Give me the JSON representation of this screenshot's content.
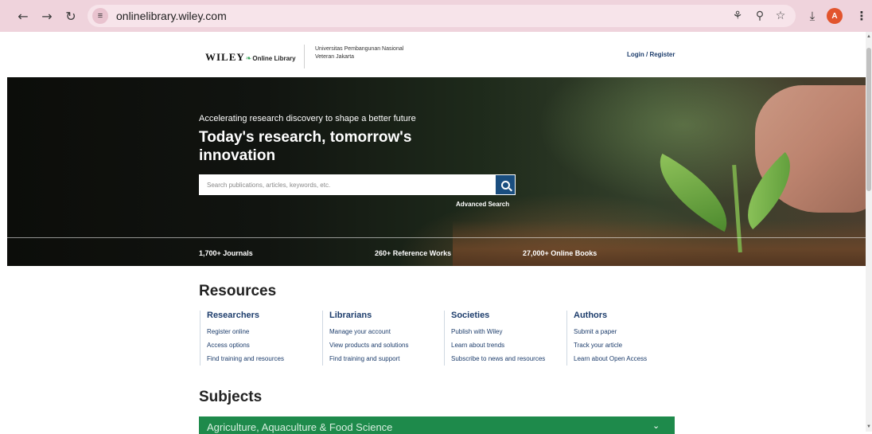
{
  "browser": {
    "url": "onlinelibrary.wiley.com",
    "avatar_letter": "A",
    "icons": {
      "back": "back-arrow-icon",
      "forward": "forward-arrow-icon",
      "reload": "reload-icon",
      "site_info": "site-settings-icon",
      "key": "password-key-icon",
      "zoom": "zoom-icon",
      "star": "bookmark-star-icon",
      "download": "download-icon",
      "menu": "kebab-menu-icon"
    }
  },
  "header": {
    "logo_wiley": "WILEY",
    "logo_sub": "Online Library",
    "institution": "Universitas Pembangunan Nasional Veteran Jakarta",
    "login": "Login / Register"
  },
  "hero": {
    "tagline": "Accelerating research discovery to shape a better future",
    "title": "Today's research, tomorrow's innovation",
    "search_placeholder": "Search publications, articles, keywords, etc.",
    "advanced_search": "Advanced Search",
    "stats": [
      "1,700+ Journals",
      "260+ Reference Works",
      "27,000+ Online Books"
    ]
  },
  "resources": {
    "title": "Resources",
    "columns": [
      {
        "heading": "Researchers",
        "links": [
          "Register online",
          "Access options",
          "Find training and resources"
        ]
      },
      {
        "heading": "Librarians",
        "links": [
          "Manage your account",
          "View products and solutions",
          "Find training and support"
        ]
      },
      {
        "heading": "Societies",
        "links": [
          "Publish with Wiley",
          "Learn about trends",
          "Subscribe to news and resources"
        ]
      },
      {
        "heading": "Authors",
        "links": [
          "Submit a paper",
          "Track your article",
          "Learn about Open Access"
        ]
      }
    ]
  },
  "subjects": {
    "title": "Subjects",
    "first": "Agriculture, Aquaculture & Food Science"
  },
  "colors": {
    "chrome_bg": "#efd3dc",
    "brand_blue": "#1d3d6c",
    "search_button": "#1a4e80",
    "subject_green": "#1e8a4b"
  }
}
